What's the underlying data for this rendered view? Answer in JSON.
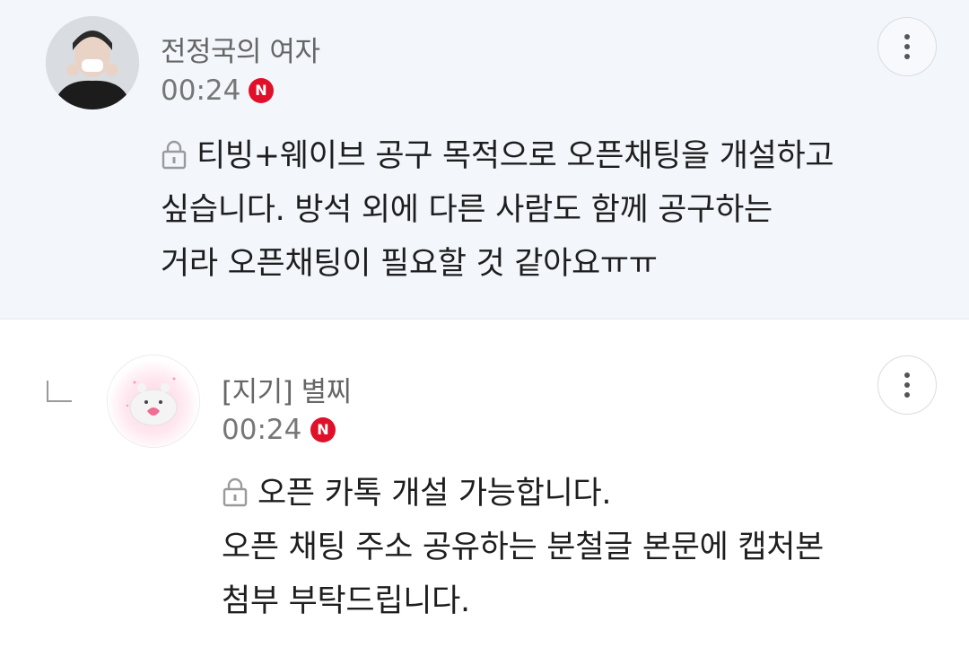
{
  "comments": [
    {
      "nickname": "전정국의 여자",
      "time": "00:24",
      "badge": "N",
      "lines": [
        "티빙+웨이브 공구 목적으로 오픈채팅을 개설하고",
        "싶습니다. 방석 외에 다른 사람도 함께 공구하는",
        "거라 오픈채팅이 필요할 것 같아요ㅠㅠ"
      ]
    },
    {
      "nickname": "[지기] 별찌",
      "time": "00:24",
      "badge": "N",
      "lines": [
        "오픈 카톡 개설 가능합니다.",
        "오픈 채팅 주소 공유하는 분철글 본문에 캡처본",
        "첨부 부탁드립니다."
      ]
    }
  ],
  "colors": {
    "badge": "#e0102a",
    "highlight_bg": "#f3f6fb"
  },
  "icons": [
    "lock-icon",
    "more-options-icon",
    "reply-arrow-icon",
    "new-badge-icon"
  ]
}
